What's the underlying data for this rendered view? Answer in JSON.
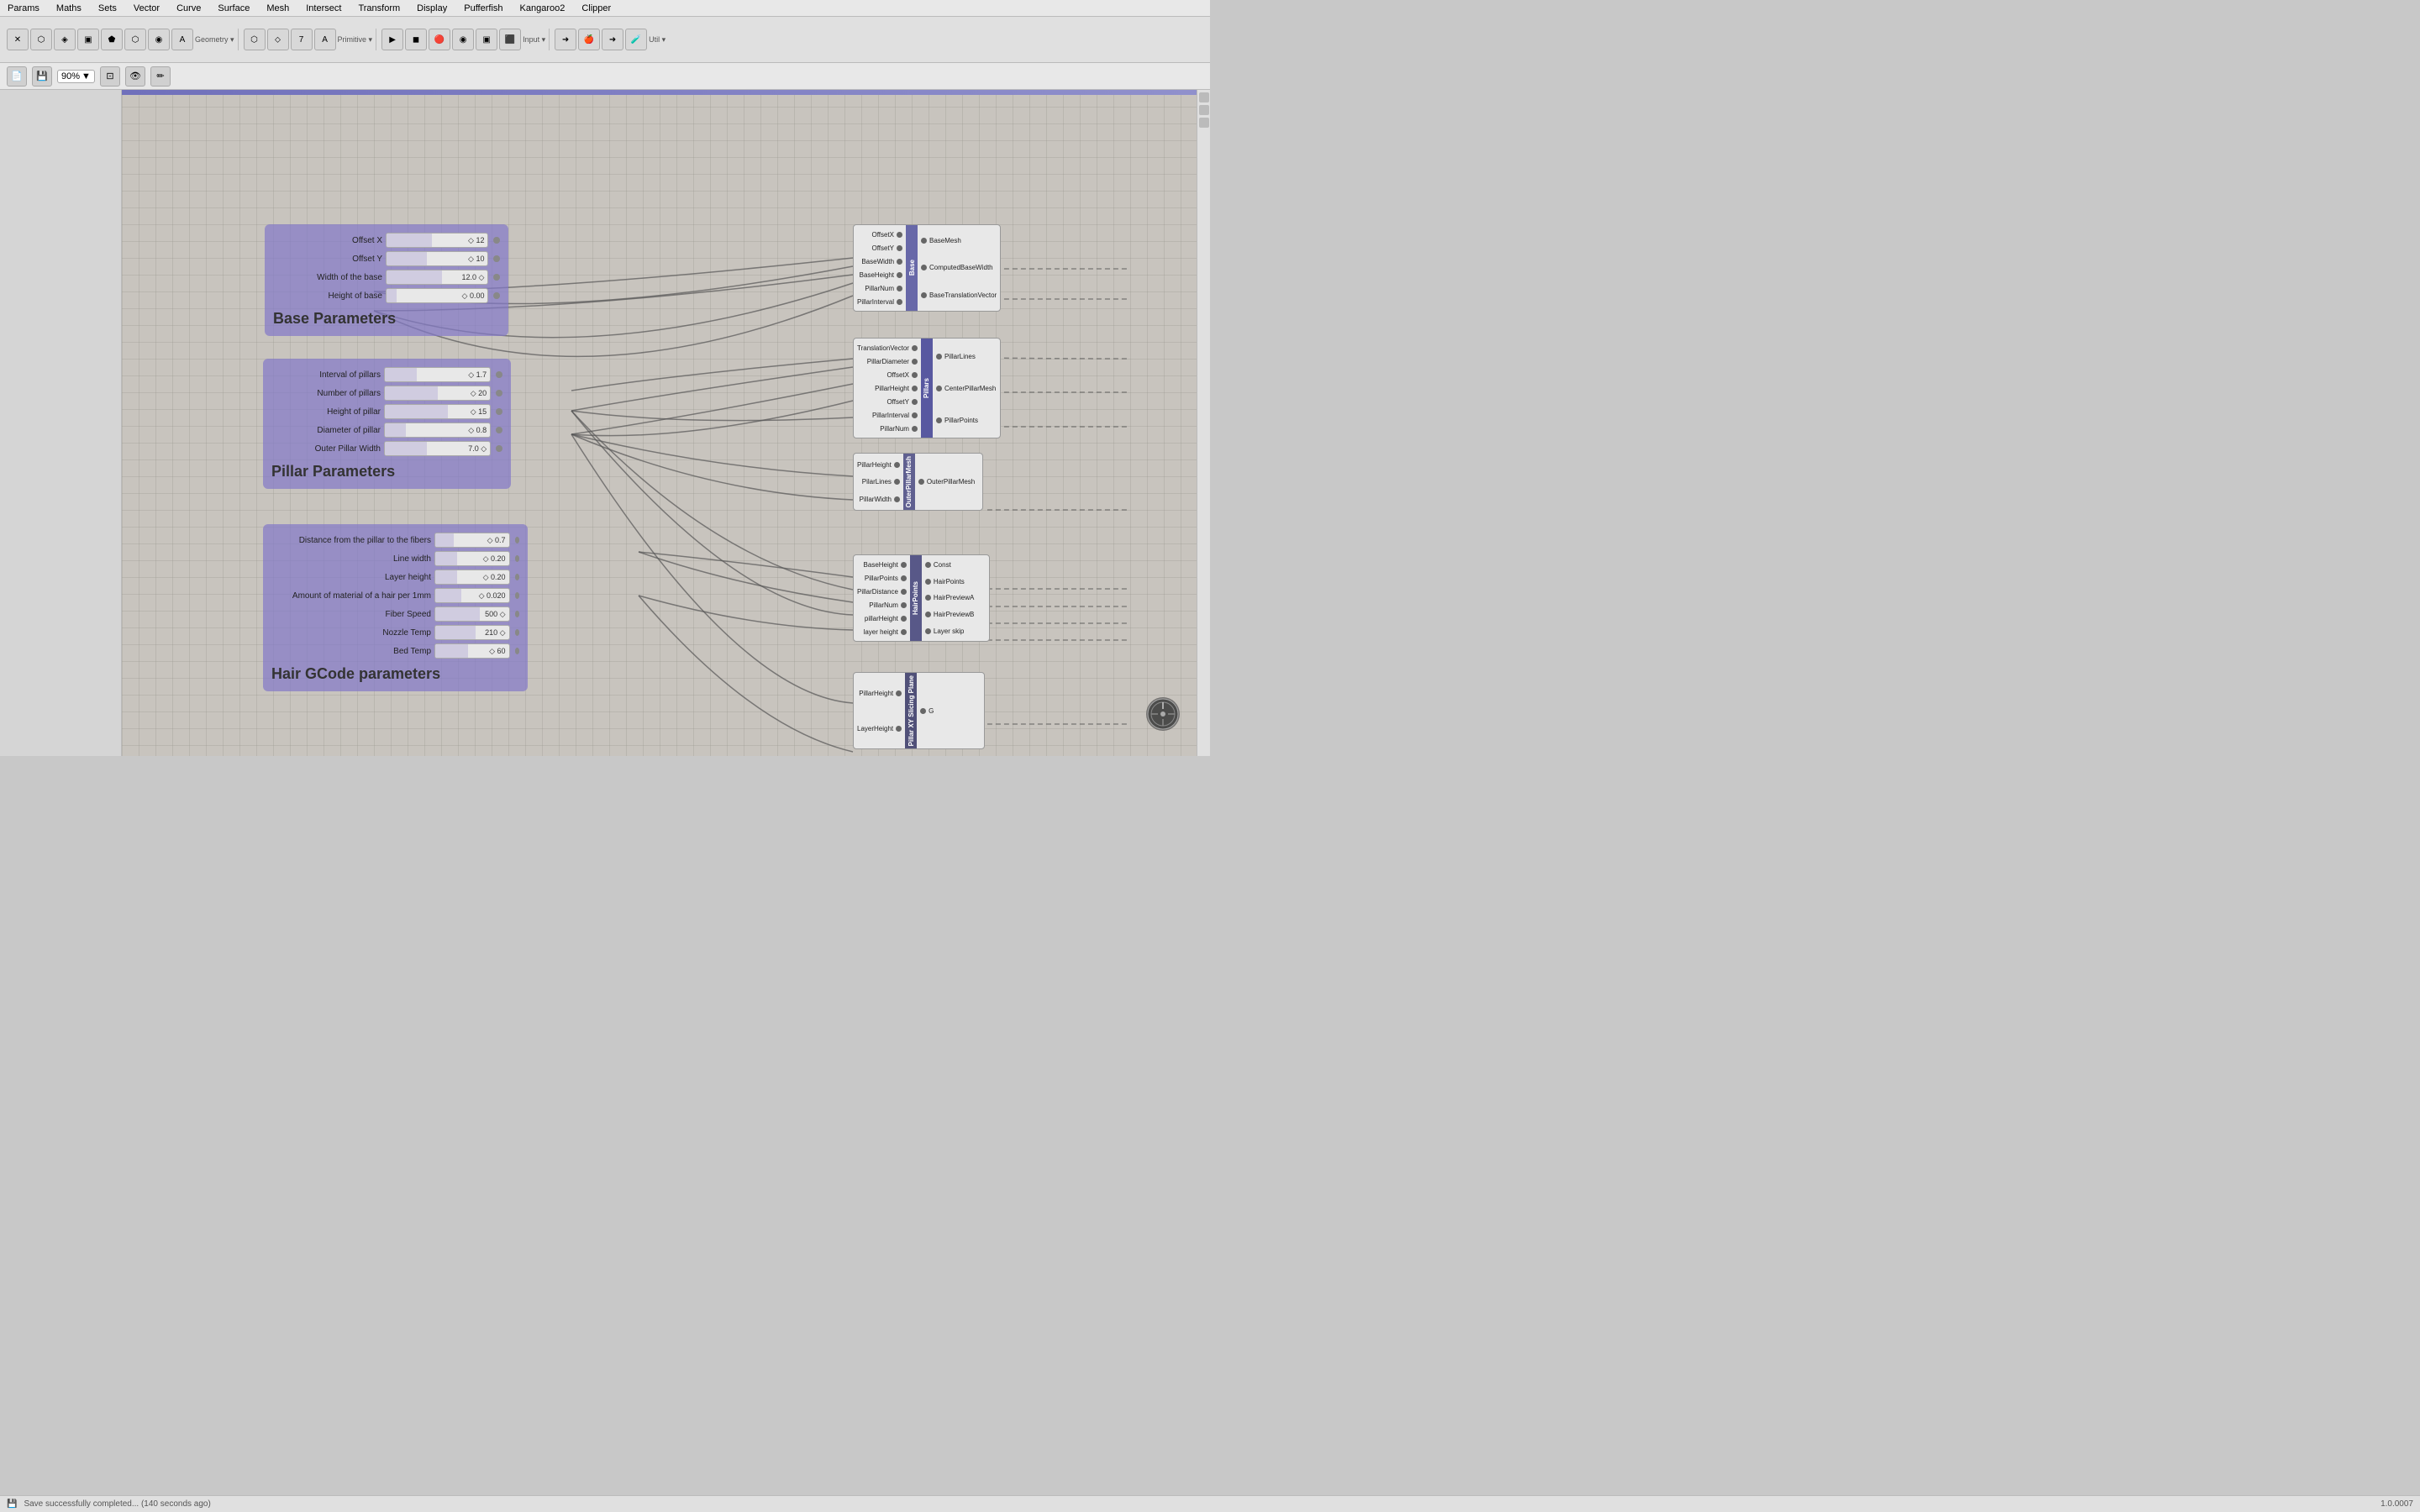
{
  "menubar": {
    "items": [
      "Params",
      "Maths",
      "Sets",
      "Vector",
      "Curve",
      "Surface",
      "Mesh",
      "Intersect",
      "Transform",
      "Display",
      "Pufferfish",
      "Kangaroo2",
      "Clipper"
    ]
  },
  "toolbar2": {
    "zoom": "90%",
    "zoom_arrow": "▼"
  },
  "base_params": {
    "title": "Base Parameters",
    "params": [
      {
        "label": "Offset X",
        "value": "◇ 12",
        "fill_pct": 45
      },
      {
        "label": "Offset Y",
        "value": "◇ 10",
        "fill_pct": 40
      },
      {
        "label": "Width of the base",
        "value": "12.0 ◇",
        "fill_pct": 55
      },
      {
        "label": "Height of base",
        "value": "◇ 0.00",
        "fill_pct": 10
      }
    ]
  },
  "pillar_params": {
    "title": "Pillar Parameters",
    "params": [
      {
        "label": "Interval of pillars",
        "value": "◇ 1.7",
        "fill_pct": 30
      },
      {
        "label": "Number of pillars",
        "value": "◇ 20",
        "fill_pct": 50
      },
      {
        "label": "Height of pillar",
        "value": "◇ 15",
        "fill_pct": 60
      },
      {
        "label": "Diameter of pillar",
        "value": "◇ 0.8",
        "fill_pct": 20
      },
      {
        "label": "Outer Pillar Width",
        "value": "7.0 ◇",
        "fill_pct": 40
      }
    ]
  },
  "hair_params": {
    "title": "Hair GCode parameters",
    "fiber_params": [
      {
        "label": "Distance from the pillar to the fibers",
        "value": "◇ 0.7",
        "fill_pct": 25
      },
      {
        "label": "Line width",
        "value": "◇ 0.20",
        "fill_pct": 30
      },
      {
        "label": "Layer height",
        "value": "◇ 0.20",
        "fill_pct": 30
      },
      {
        "label": "Amount of material of a hair per 1mm",
        "value": "◇ 0.020",
        "fill_pct": 35
      },
      {
        "label": "Fiber Speed",
        "value": "500 ◇",
        "fill_pct": 60
      }
    ],
    "temp_params": [
      {
        "label": "Nozzle Temp",
        "value": "210 ◇",
        "fill_pct": 55
      },
      {
        "label": "Bed Temp",
        "value": "◇ 60",
        "fill_pct": 45
      }
    ]
  },
  "base_node": {
    "inputs": [
      "OffsetX",
      "OffsetY",
      "BaseWidth",
      "BaseHeight",
      "PillarNum",
      "PillarInterval"
    ],
    "label": "Base",
    "outputs": [
      "BaseMesh",
      "ComputedBaseWidth",
      "BaseTranslationVector"
    ]
  },
  "pillars_node": {
    "inputs": [
      "TranslationVector",
      "PillarDiameter",
      "OffsetX",
      "PillarHeight",
      "OffsetY",
      "PillarInterval",
      "PillarNum"
    ],
    "label": "Pillars",
    "outputs": [
      "PillarLines",
      "CenterPillarMesh",
      "PillarPoints"
    ]
  },
  "outer_pillar_node": {
    "inputs": [
      "PillarHeight",
      "PilarLines",
      "PillarWidth"
    ],
    "label": "OuterPillarMesh",
    "outputs": [
      "OuterPillarMesh"
    ]
  },
  "hair_points_node": {
    "inputs": [
      "BaseHeight",
      "PillarPoints",
      "PillarDistance",
      "PillarNum",
      "pillarHeight",
      "layer height"
    ],
    "label": "HairPoints",
    "outputs": [
      "Const",
      "HairPoints",
      "HairPreviewA",
      "HairPreviewB",
      "Layer skip"
    ]
  },
  "pillar_xy_node": {
    "inputs": [
      "PillarHeight",
      "LayerHeight"
    ],
    "label": "Pillar XY Slicing Plane",
    "outputs": [
      "G"
    ]
  },
  "status": {
    "message": "Save successfully completed... (140 seconds ago)",
    "coordinates": "1.0.0007"
  }
}
